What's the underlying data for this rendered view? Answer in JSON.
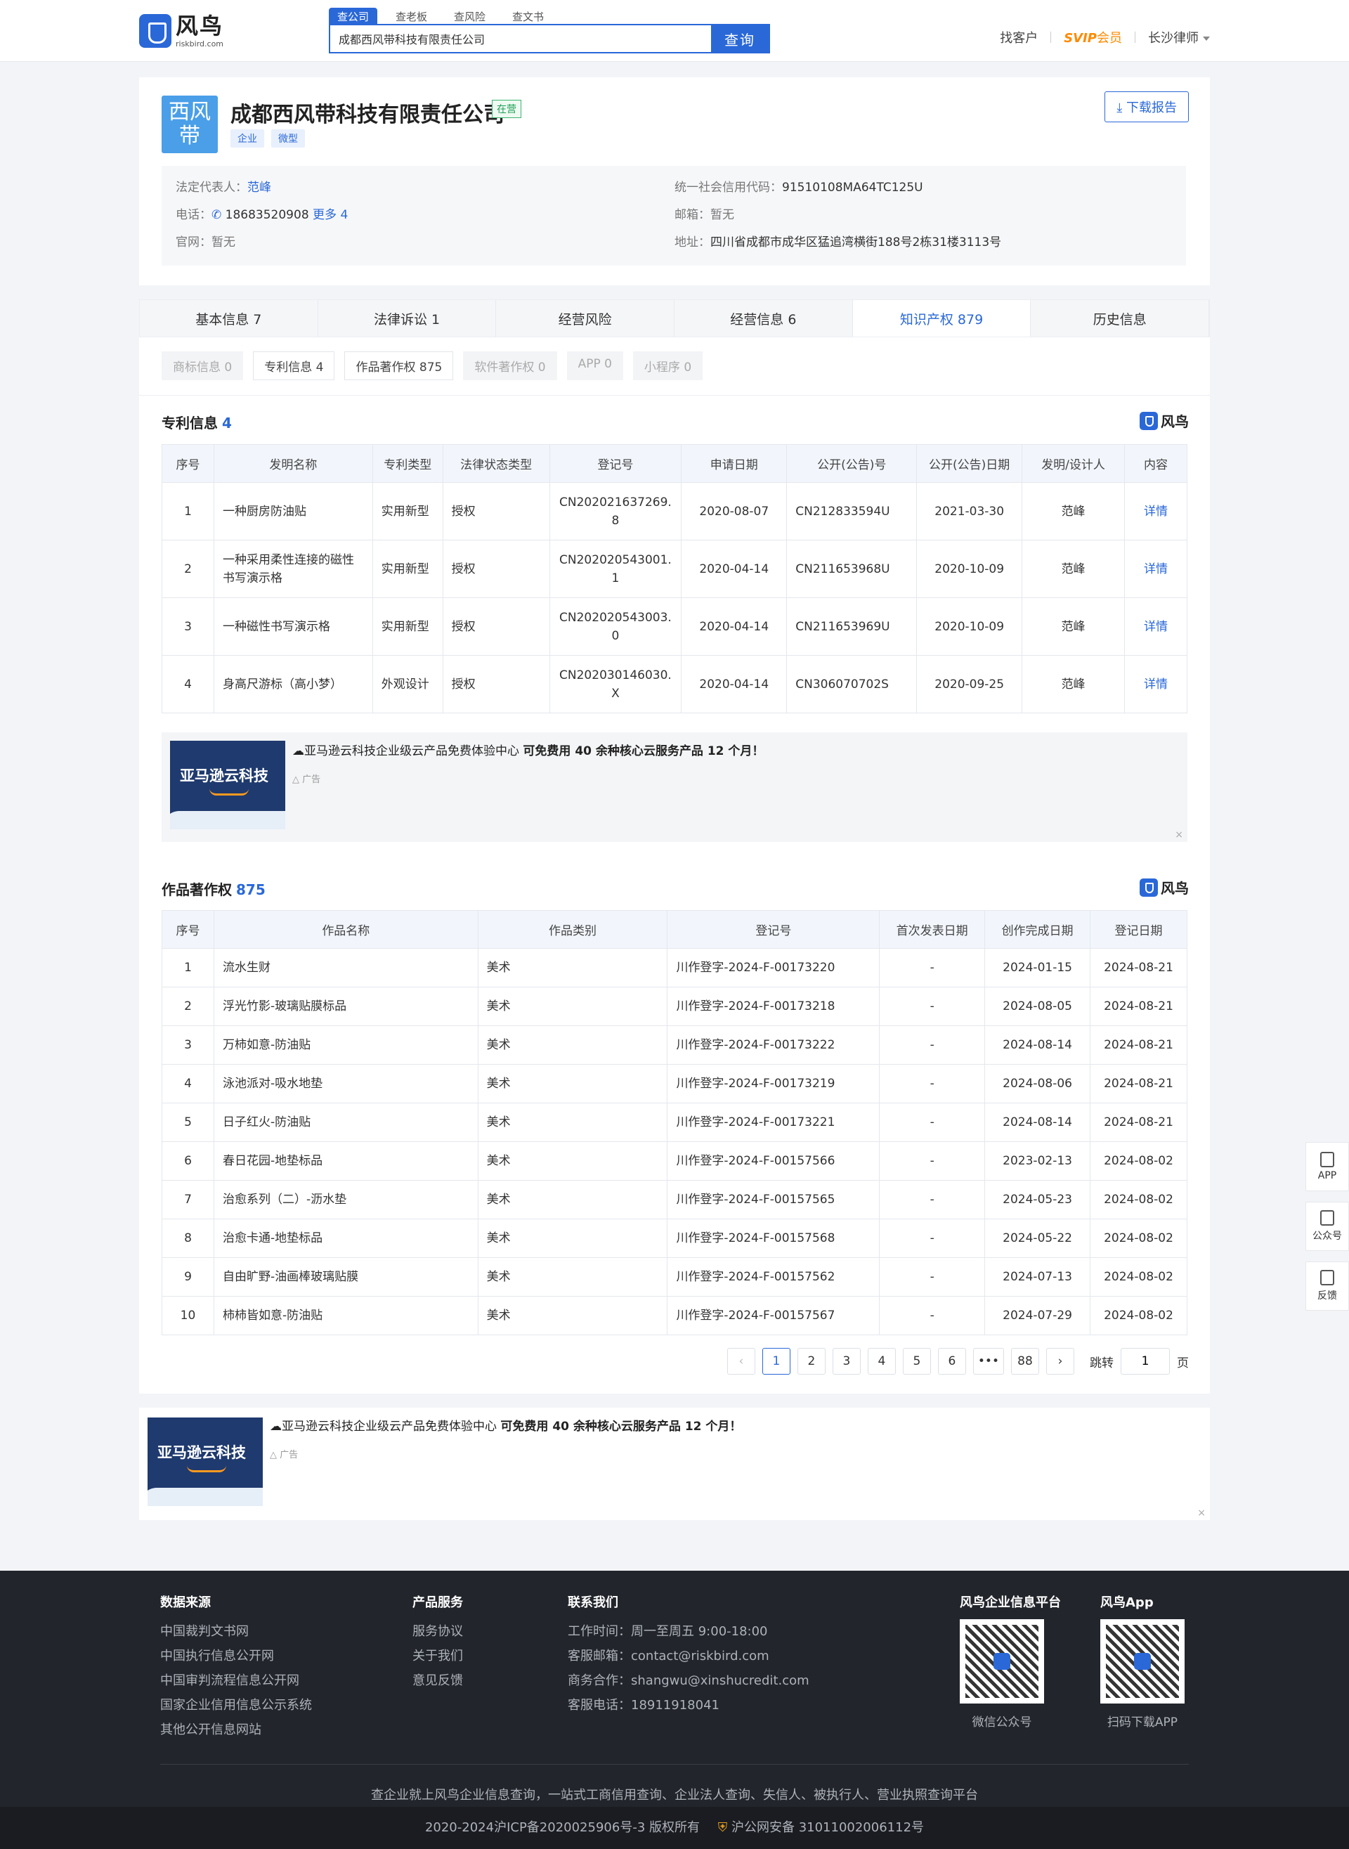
{
  "header": {
    "logo_cn": "风鸟",
    "logo_en": "riskbird.com",
    "search_tabs": [
      "查公司",
      "查老板",
      "查风险",
      "查文书"
    ],
    "search_value": "成都西风带科技有限责任公司",
    "search_button": "查询",
    "nav_find": "找客户",
    "nav_svip": "SVIP",
    "nav_member": "会员",
    "nav_user": "长沙律师"
  },
  "company": {
    "logo_text": "西风带",
    "name": "成都西风带科技有限责任公司",
    "status": "在营",
    "tags": [
      "企业",
      "微型"
    ],
    "download": "下载报告",
    "legal_label": "法定代表人：",
    "legal_value": "范峰",
    "phone_label": "电话：",
    "phone_value": "18683520908",
    "phone_more": "更多 4",
    "web_label": "官网：",
    "web_value": "暂无",
    "credit_label": "统一社会信用代码：",
    "credit_value": "91510108MA64TC125U",
    "email_label": "邮箱：",
    "email_value": "暂无",
    "addr_label": "地址：",
    "addr_value": "四川省成都市成华区猛追湾横街188号2栋31楼3113号"
  },
  "tabs": [
    "基本信息 7",
    "法律诉讼 1",
    "经营风险",
    "经营信息 6",
    "知识产权 879",
    "历史信息"
  ],
  "subtabs": [
    {
      "label": "商标信息 0",
      "enabled": false
    },
    {
      "label": "专利信息 4",
      "enabled": true
    },
    {
      "label": "作品著作权 875",
      "enabled": true
    },
    {
      "label": "软件著作权 0",
      "enabled": false
    },
    {
      "label": "APP 0",
      "enabled": false
    },
    {
      "label": "小程序 0",
      "enabled": false
    }
  ],
  "patents": {
    "title": "专利信息",
    "count": "4",
    "watermark": "风鸟",
    "headers": [
      "序号",
      "发明名称",
      "专利类型",
      "法律状态类型",
      "登记号",
      "申请日期",
      "公开(公告)号",
      "公开(公告)日期",
      "发明/设计人",
      "内容"
    ],
    "rows": [
      [
        "1",
        "一种厨房防油贴",
        "实用新型",
        "授权",
        "CN202021637269.8",
        "2020-08-07",
        "CN212833594U",
        "2021-03-30",
        "范峰",
        "详情"
      ],
      [
        "2",
        "一种采用柔性连接的磁性书写演示格",
        "实用新型",
        "授权",
        "CN202020543001.1",
        "2020-04-14",
        "CN211653968U",
        "2020-10-09",
        "范峰",
        "详情"
      ],
      [
        "3",
        "一种磁性书写演示格",
        "实用新型",
        "授权",
        "CN202020543003.0",
        "2020-04-14",
        "CN211653969U",
        "2020-10-09",
        "范峰",
        "详情"
      ],
      [
        "4",
        "身高尺游标（高小梦）",
        "外观设计",
        "授权",
        "CN202030146030.X",
        "2020-04-14",
        "CN306070702S",
        "2020-09-25",
        "范峰",
        "详情"
      ]
    ]
  },
  "ad": {
    "image_text": "亚马逊云科技",
    "text_prefix": "亚马逊云科技企业级云产品免费体验中心",
    "text_bold": "可免费用 40 余种核心云服务产品 12 个月！",
    "label": "广告",
    "close": "×"
  },
  "works": {
    "title": "作品著作权",
    "count": "875",
    "watermark": "风鸟",
    "headers": [
      "序号",
      "作品名称",
      "作品类别",
      "登记号",
      "首次发表日期",
      "创作完成日期",
      "登记日期"
    ],
    "rows": [
      [
        "1",
        "流水生财",
        "美术",
        "川作登字-2024-F-00173220",
        "-",
        "2024-01-15",
        "2024-08-21"
      ],
      [
        "2",
        "浮光竹影-玻璃贴膜标品",
        "美术",
        "川作登字-2024-F-00173218",
        "-",
        "2024-08-05",
        "2024-08-21"
      ],
      [
        "3",
        "万柿如意-防油贴",
        "美术",
        "川作登字-2024-F-00173222",
        "-",
        "2024-08-14",
        "2024-08-21"
      ],
      [
        "4",
        "泳池派对-吸水地垫",
        "美术",
        "川作登字-2024-F-00173219",
        "-",
        "2024-08-06",
        "2024-08-21"
      ],
      [
        "5",
        "日子红火-防油贴",
        "美术",
        "川作登字-2024-F-00173221",
        "-",
        "2024-08-14",
        "2024-08-21"
      ],
      [
        "6",
        "春日花园-地垫标品",
        "美术",
        "川作登字-2024-F-00157566",
        "-",
        "2023-02-13",
        "2024-08-02"
      ],
      [
        "7",
        "治愈系列（二）-沥水垫",
        "美术",
        "川作登字-2024-F-00157565",
        "-",
        "2024-05-23",
        "2024-08-02"
      ],
      [
        "8",
        "治愈卡通-地垫标品",
        "美术",
        "川作登字-2024-F-00157568",
        "-",
        "2024-05-22",
        "2024-08-02"
      ],
      [
        "9",
        "自由旷野-油画棒玻璃贴膜",
        "美术",
        "川作登字-2024-F-00157562",
        "-",
        "2024-07-13",
        "2024-08-02"
      ],
      [
        "10",
        "柿柿皆如意-防油贴",
        "美术",
        "川作登字-2024-F-00157567",
        "-",
        "2024-07-29",
        "2024-08-02"
      ]
    ]
  },
  "pager": {
    "prev": "‹",
    "pages": [
      "1",
      "2",
      "3",
      "4",
      "5",
      "6",
      "•••",
      "88"
    ],
    "current": "1",
    "next": "›",
    "jump_label": "跳转",
    "jump_value": "1",
    "page_label": "页"
  },
  "side": [
    "APP",
    "公众号",
    "反馈"
  ],
  "footer": {
    "src_title": "数据来源",
    "src_items": [
      "中国裁判文书网",
      "中国执行信息公开网",
      "中国审判流程信息公开网",
      "国家企业信用信息公示系统",
      "其他公开信息网站"
    ],
    "svc_title": "产品服务",
    "svc_items": [
      "服务协议",
      "关于我们",
      "意见反馈"
    ],
    "contact_title": "联系我们",
    "contact_items": [
      "工作时间：周一至周五 9:00-18:00",
      "客服邮箱：contact@riskbird.com",
      "商务合作：shangwu@xinshucredit.com",
      "客服电话：18911918041"
    ],
    "qr1_title": "风鸟企业信息平台",
    "qr1_caption": "微信公众号",
    "qr2_title": "风鸟App",
    "qr2_caption": "扫码下载APP",
    "slogan": "查企业就上风鸟企业信息查询，一站式工商信用查询、企业法人查询、失信人、被执行人、营业执照查询平台",
    "copyright": "2020-2024沪ICP备2020025906号-3 版权所有",
    "police": "沪公网安备 31011002006112号"
  }
}
